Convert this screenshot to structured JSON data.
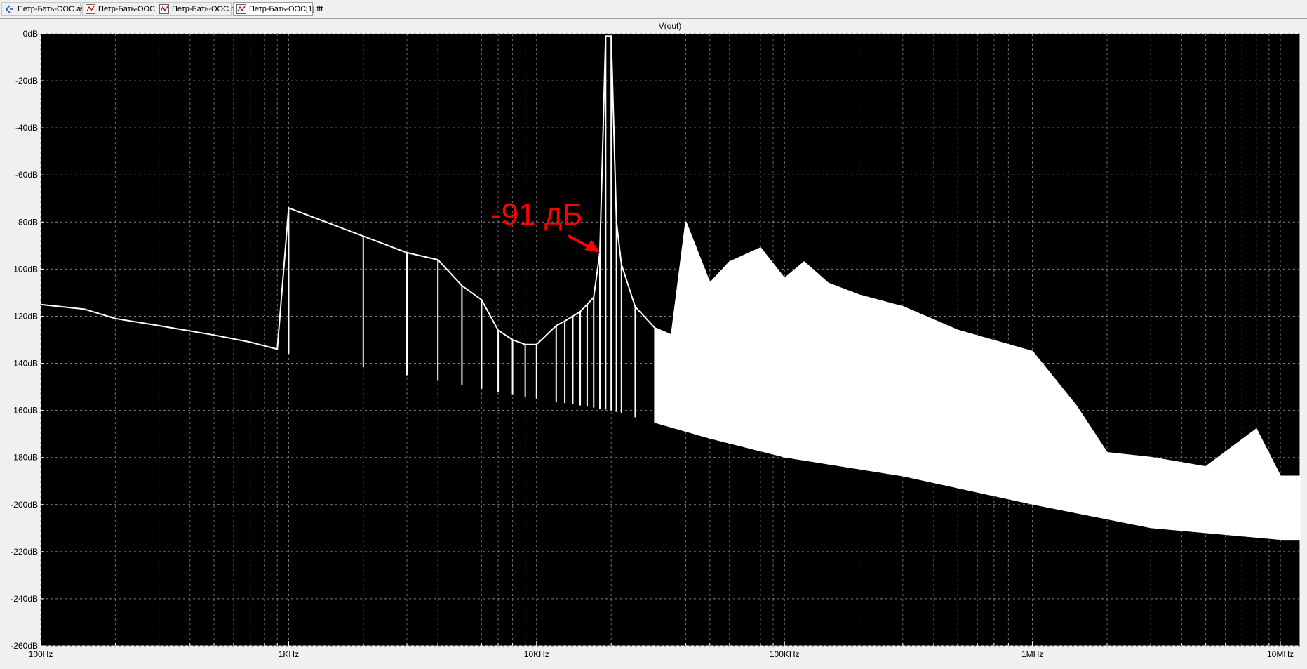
{
  "tabs": [
    {
      "label": "Петр-Бать-ООС.asc",
      "icon": "schematic-icon",
      "active": false
    },
    {
      "label": "Петр-Бать-ООС.fft",
      "icon": "waveform-icon",
      "active": false
    },
    {
      "label": "Петр-Бать-ООС.raw",
      "icon": "waveform-icon",
      "active": false
    },
    {
      "label": "Петр-Бать-ООС[1].fft",
      "icon": "waveform-icon",
      "active": true
    }
  ],
  "colors": {
    "plot_background": "#000000",
    "trace": "#ffffff",
    "grid": "#808080",
    "axis_text": "#000000",
    "annotation": "#ff0000"
  },
  "chart_data": {
    "type": "line",
    "title": "V(out)",
    "x_scale": "log",
    "xlim": [
      100,
      12000000
    ],
    "ylim": [
      -260,
      0
    ],
    "grid": true,
    "x_ticks": [
      {
        "value": 100,
        "label": "100Hz"
      },
      {
        "value": 1000,
        "label": "1KHz"
      },
      {
        "value": 10000,
        "label": "10KHz"
      },
      {
        "value": 100000,
        "label": "100KHz"
      },
      {
        "value": 1000000,
        "label": "1MHz"
      },
      {
        "value": 10000000,
        "label": "10MHz"
      }
    ],
    "y_ticks": [
      {
        "value": 0,
        "label": "0dB"
      },
      {
        "value": -20,
        "label": "-20dB"
      },
      {
        "value": -40,
        "label": "-40dB"
      },
      {
        "value": -60,
        "label": "-60dB"
      },
      {
        "value": -80,
        "label": "-80dB"
      },
      {
        "value": -100,
        "label": "-100dB"
      },
      {
        "value": -120,
        "label": "-120dB"
      },
      {
        "value": -140,
        "label": "-140dB"
      },
      {
        "value": -160,
        "label": "-160dB"
      },
      {
        "value": -180,
        "label": "-180dB"
      },
      {
        "value": -200,
        "label": "-200dB"
      },
      {
        "value": -220,
        "label": "-220dB"
      },
      {
        "value": -240,
        "label": "-240dB"
      },
      {
        "value": -260,
        "label": "-260dB"
      }
    ],
    "series": [
      {
        "points": [
          [
            100,
            -115
          ],
          [
            150,
            -117
          ],
          [
            200,
            -121
          ],
          [
            300,
            -124
          ],
          [
            500,
            -128
          ],
          [
            700,
            -131
          ],
          [
            900,
            -134
          ],
          [
            1000,
            -74
          ],
          [
            2000,
            -86
          ],
          [
            3000,
            -93
          ],
          [
            4000,
            -96
          ],
          [
            5000,
            -107
          ],
          [
            6000,
            -113
          ],
          [
            7000,
            -126
          ],
          [
            8000,
            -130
          ],
          [
            9000,
            -132
          ],
          [
            10000,
            -132
          ],
          [
            12000,
            -124
          ],
          [
            13000,
            -122
          ],
          [
            14000,
            -120
          ],
          [
            15000,
            -118
          ],
          [
            16000,
            -115
          ],
          [
            17000,
            -112
          ],
          [
            18000,
            -93
          ],
          [
            19000,
            -1
          ],
          [
            20000,
            -1
          ],
          [
            21000,
            -80
          ],
          [
            22000,
            -98
          ],
          [
            25000,
            -116
          ],
          [
            30000,
            -125
          ],
          [
            35000,
            -128
          ],
          [
            40000,
            -80
          ],
          [
            50000,
            -106
          ],
          [
            60000,
            -97
          ],
          [
            80000,
            -91
          ],
          [
            100000,
            -104
          ],
          [
            120000,
            -97
          ],
          [
            150000,
            -106
          ],
          [
            200000,
            -111
          ],
          [
            300000,
            -116
          ],
          [
            500000,
            -126
          ],
          [
            1000000,
            -135
          ],
          [
            1500000,
            -158
          ],
          [
            2000000,
            -178
          ],
          [
            3000000,
            -180
          ],
          [
            5000000,
            -184
          ],
          [
            8000000,
            -168
          ],
          [
            10000000,
            -188
          ],
          [
            12000000,
            -188
          ]
        ],
        "noise_floor": [
          [
            100,
            -115
          ],
          [
            1000,
            -136
          ],
          [
            10000,
            -155
          ],
          [
            20000,
            -160
          ],
          [
            50000,
            -172
          ],
          [
            100000,
            -180
          ],
          [
            300000,
            -188
          ],
          [
            1000000,
            -200
          ],
          [
            3000000,
            -210
          ],
          [
            10000000,
            -215
          ],
          [
            12000000,
            -215
          ]
        ]
      }
    ],
    "annotations": [
      {
        "text": "-91 дБ",
        "points_to": [
          18000,
          -93
        ]
      }
    ]
  }
}
